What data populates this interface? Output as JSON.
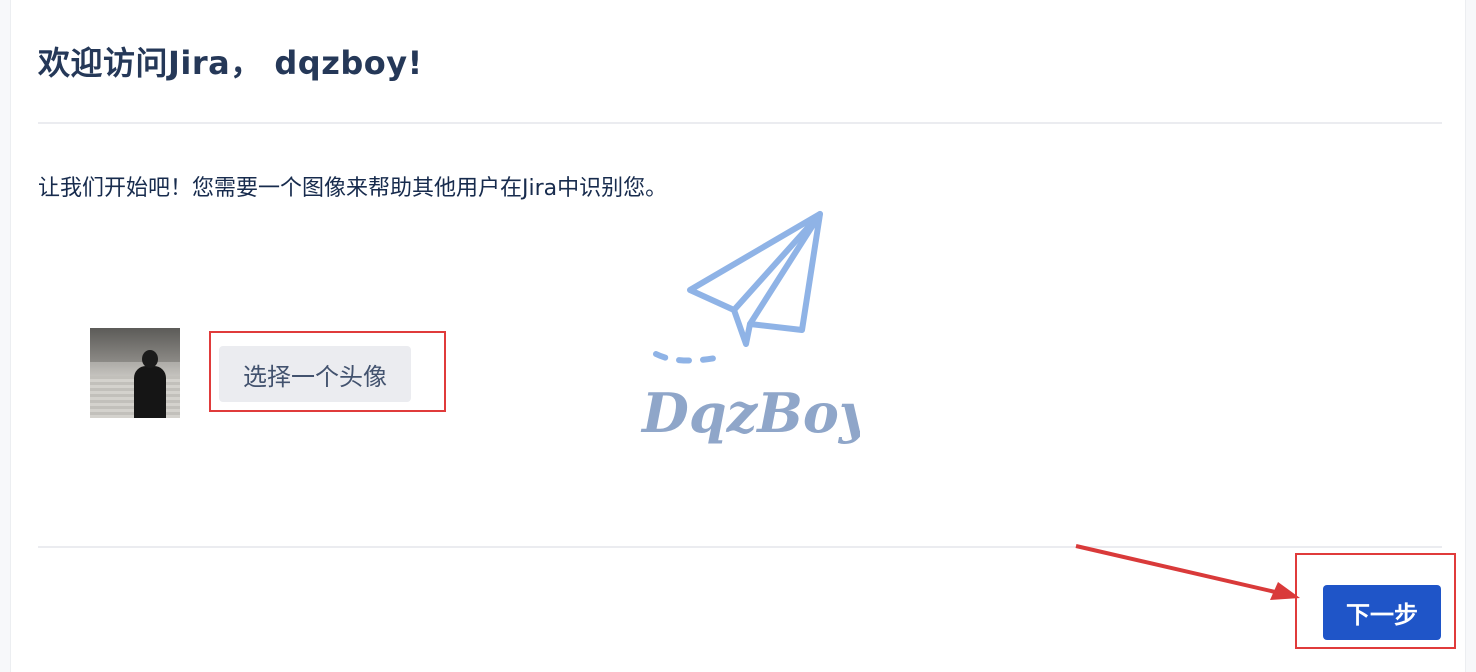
{
  "header": {
    "title": "欢迎访问Jira， dqzboy!"
  },
  "intro": {
    "text": "让我们开始吧！您需要一个图像来帮助其他用户在Jira中识别您。"
  },
  "avatar": {
    "choose_label": "选择一个头像"
  },
  "watermark": {
    "text": "DqzBoy"
  },
  "footer": {
    "next_label": "下一步"
  },
  "colors": {
    "primary": "#1f55c8",
    "highlight": "#e03b3b",
    "watermark": "#8fb3e6",
    "title": "#253858",
    "button_bg": "#ebecf0"
  }
}
